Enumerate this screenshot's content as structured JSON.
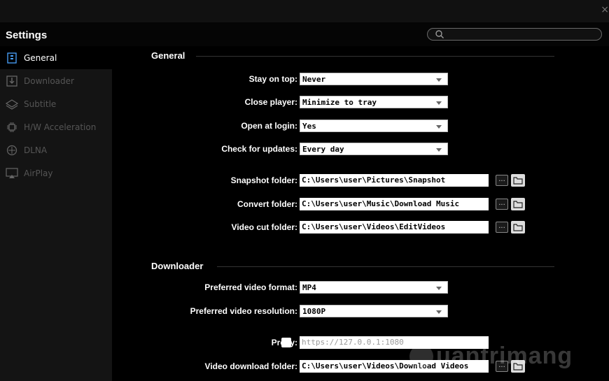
{
  "window": {
    "title": "Settings",
    "close_glyph": "×"
  },
  "search": {
    "placeholder": "",
    "icon": "search-icon"
  },
  "sidebar": {
    "items": [
      {
        "label": "General",
        "icon": "general-icon",
        "active": true
      },
      {
        "label": "Downloader",
        "icon": "downloader-icon",
        "active": false
      },
      {
        "label": "Subtitle",
        "icon": "subtitle-icon",
        "active": false
      },
      {
        "label": "H/W Acceleration",
        "icon": "chip-icon",
        "active": false
      },
      {
        "label": "DLNA",
        "icon": "dlna-icon",
        "active": false
      },
      {
        "label": "AirPlay",
        "icon": "airplay-icon",
        "active": false
      }
    ]
  },
  "general": {
    "heading": "General",
    "stay_on_top": {
      "label": "Stay on top:",
      "value": "Never"
    },
    "close_player": {
      "label": "Close player:",
      "value": "Minimize to tray"
    },
    "open_at_login": {
      "label": "Open at login:",
      "value": "Yes"
    },
    "check_updates": {
      "label": "Check for updates:",
      "value": "Every day"
    },
    "snapshot_folder": {
      "label": "Snapshot folder:",
      "value": "C:\\Users\\user\\Pictures\\Snapshot"
    },
    "convert_folder": {
      "label": "Convert folder:",
      "value": "C:\\Users\\user\\Music\\Download Music"
    },
    "video_cut_folder": {
      "label": "Video cut folder:",
      "value": "C:\\Users\\user\\Videos\\EditVideos"
    }
  },
  "downloader": {
    "heading": "Downloader",
    "video_format": {
      "label": "Preferred video format:",
      "value": "MP4"
    },
    "video_resolution": {
      "label": "Preferred video resolution:",
      "value": "1080P"
    },
    "proxy": {
      "label": "Proxy:",
      "checked": false,
      "placeholder": "https://127.0.0.1:1080"
    },
    "download_folder": {
      "label": "Video download folder:",
      "value": "C:\\Users\\user\\Videos\\Download Videos"
    }
  },
  "browse_label": "...",
  "watermark": "uantrimang",
  "colors": {
    "background": "#000000",
    "sidebar": "#141414",
    "active_text": "#ffffff",
    "inactive_text": "#555555"
  }
}
